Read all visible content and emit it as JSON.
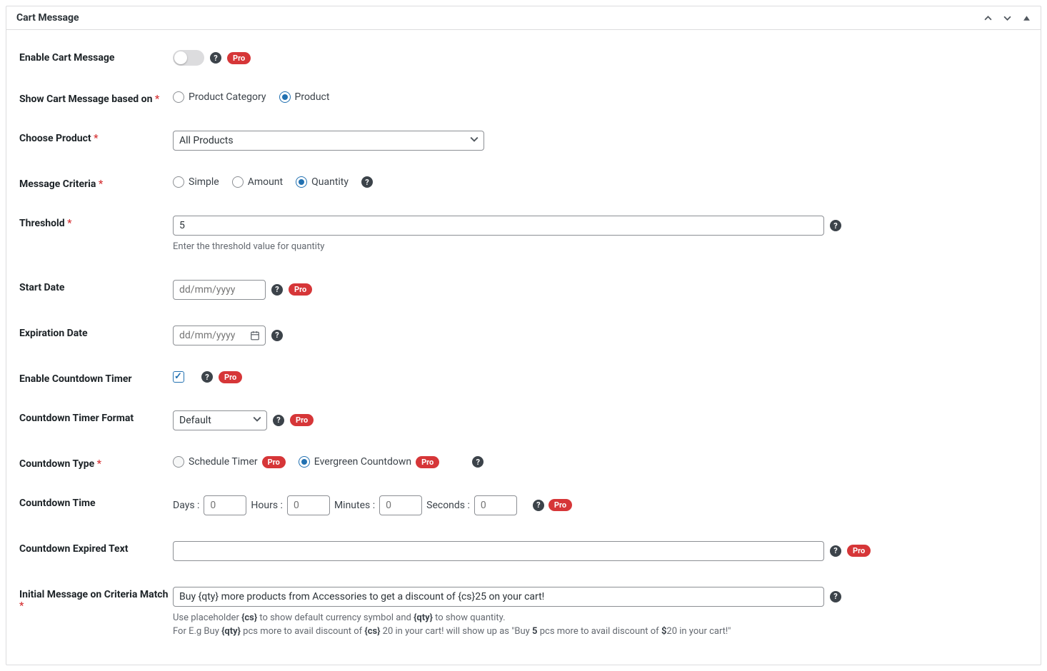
{
  "panel": {
    "title": "Cart Message"
  },
  "badges": {
    "pro": "Pro"
  },
  "fields": {
    "enable": {
      "label": "Enable Cart Message"
    },
    "basedOn": {
      "label": "Show Cart Message based on",
      "options": {
        "category": "Product Category",
        "product": "Product"
      }
    },
    "chooseProduct": {
      "label": "Choose Product",
      "value": "All Products"
    },
    "criteria": {
      "label": "Message Criteria",
      "options": {
        "simple": "Simple",
        "amount": "Amount",
        "quantity": "Quantity"
      }
    },
    "threshold": {
      "label": "Threshold",
      "value": "5",
      "help": "Enter the threshold value for quantity"
    },
    "startDate": {
      "label": "Start Date",
      "placeholder": "dd/mm/yyyy"
    },
    "expirationDate": {
      "label": "Expiration Date",
      "placeholder": "dd/mm/yyyy"
    },
    "enableCountdown": {
      "label": "Enable Countdown Timer"
    },
    "countdownFormat": {
      "label": "Countdown Timer Format",
      "value": "Default"
    },
    "countdownType": {
      "label": "Countdown Type",
      "options": {
        "schedule": "Schedule Timer",
        "evergreen": "Evergreen Countdown"
      }
    },
    "countdownTime": {
      "label": "Countdown Time",
      "days": "Days :",
      "hours": "Hours :",
      "minutes": "Minutes :",
      "seconds": "Seconds :",
      "placeholder": "0"
    },
    "expiredText": {
      "label": "Countdown Expired Text"
    },
    "initialMessage": {
      "label": "Initial Message on Criteria Match",
      "value": "Buy {qty} more products from Accessories to get a discount of {cs}25 on your cart!",
      "help1a": "Use placeholder ",
      "help1b": "{cs}",
      "help1c": " to show default currency symbol and ",
      "help1d": "{qty}",
      "help1e": " to show quantity.",
      "help2a": "For E.g Buy ",
      "help2b": "{qty}",
      "help2c": " pcs more to avail discount of ",
      "help2d": "{cs}",
      "help2e": " 20 in your cart! will show up as \"Buy ",
      "help2f": "5",
      "help2g": " pcs more to avail discount of ",
      "help2h": "$",
      "help2i": "20 in your cart!\""
    }
  }
}
